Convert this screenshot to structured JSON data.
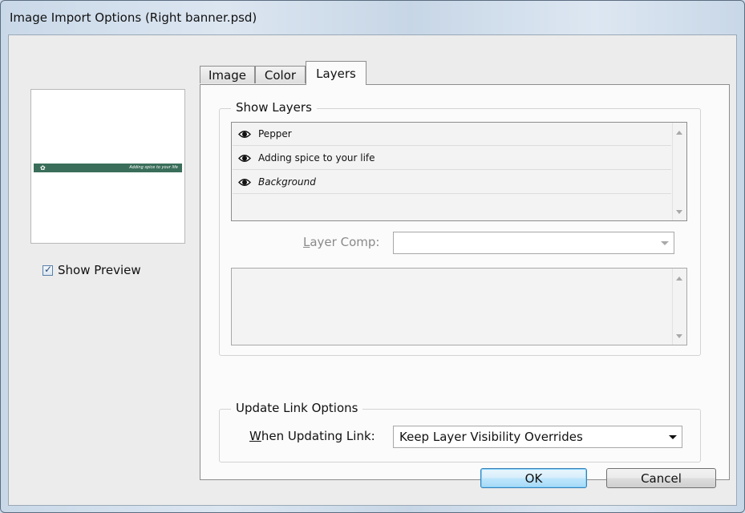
{
  "window": {
    "title": "Image Import Options (Right banner.psd)"
  },
  "preview": {
    "banner_text": "Adding spice to your life",
    "banner_color": "#3a6e5a",
    "show_preview_label": "Show Preview",
    "show_preview_checked": true
  },
  "tabs": [
    {
      "label": "Image",
      "active": false
    },
    {
      "label": "Color",
      "active": false
    },
    {
      "label": "Layers",
      "active": true
    }
  ],
  "show_layers": {
    "title": "Show Layers",
    "layers": [
      {
        "name": "Pepper",
        "visible": true,
        "italic": false
      },
      {
        "name": "Adding spice to your life",
        "visible": true,
        "italic": false
      },
      {
        "name": "Background",
        "visible": true,
        "italic": true
      }
    ],
    "layer_comp": {
      "label_prefix": "",
      "label_mnemonic": "L",
      "label_rest": "ayer Comp:",
      "value": ""
    }
  },
  "update_link": {
    "title": "Update Link Options",
    "label_mnemonic": "W",
    "label_rest": "hen Updating Link:",
    "value": "Keep Layer Visibility Overrides"
  },
  "buttons": {
    "ok": "OK",
    "cancel": "Cancel"
  },
  "colors": {
    "default_button": "#a7d9f5",
    "disabled_text": "#8a8a8a"
  }
}
